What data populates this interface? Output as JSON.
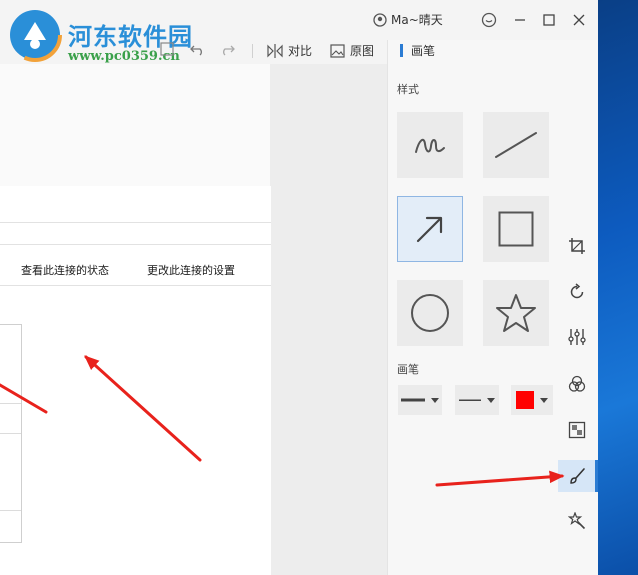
{
  "app": {
    "user_name": "Ma~晴天",
    "logo_text": "河东软件园",
    "logo_url": "www.pc0359.cn",
    "accent": "#2b7cd3"
  },
  "toolbar": {
    "compare_label": "对比",
    "original_label": "原图",
    "panel_title": "画笔"
  },
  "panel": {
    "style_label": "样式",
    "pen_label": "画笔",
    "shapes": [
      "scribble",
      "line",
      "arrow",
      "rectangle",
      "circle",
      "star"
    ],
    "selected_shape": "arrow",
    "pen_color": "#ff0000"
  },
  "screenshot_content": {
    "link_status": "查看此连接的状态",
    "link_settings": "更改此连接的设置"
  },
  "rail": {
    "tools": [
      "crop-icon",
      "rotate-icon",
      "adjust-icon",
      "color-icon",
      "mosaic-icon",
      "brush-icon",
      "magic-icon"
    ],
    "selected": "brush-icon"
  },
  "annotation_color": "#e8221c"
}
